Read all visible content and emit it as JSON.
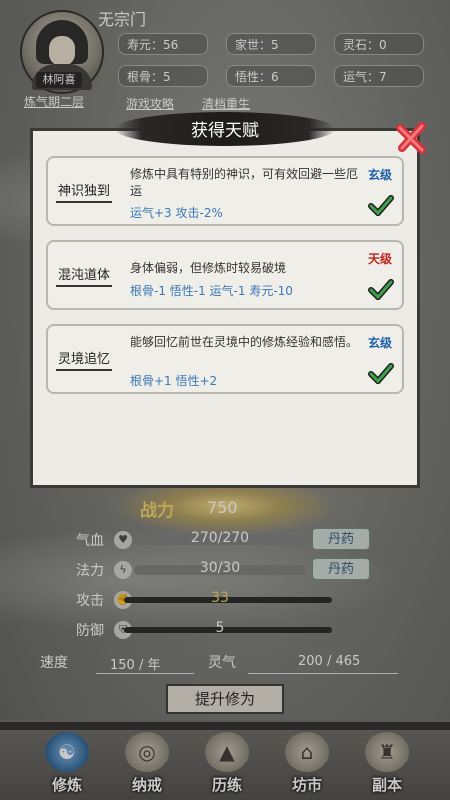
{
  "header": {
    "sect": "无宗门",
    "name": "林阿喜",
    "realm": "炼气期二层",
    "stats": {
      "lifespan": "寿元：56",
      "family": "家世：5",
      "spirit_stone": "灵石：0",
      "bone": "根骨：5",
      "comprehension": "悟性：6",
      "luck": "运气：7"
    },
    "links": {
      "guide": "游戏攻略",
      "reset": "清档重生"
    }
  },
  "modal": {
    "title": "获得天赋",
    "talents": [
      {
        "name": "神识独到",
        "desc": "修炼中具有特别的神识，可有效回避一些厄运",
        "effects": "运气+3  攻击-2%",
        "grade": "玄级",
        "grade_color": "#1f5fa8"
      },
      {
        "name": "混沌道体",
        "desc": "身体偏弱，但修炼时较易破境",
        "effects": "根骨-1  悟性-1  运气-1  寿元-10",
        "grade": "天级",
        "grade_color": "#c0241c"
      },
      {
        "name": "灵境追忆",
        "desc": "能够回忆前世在灵境中的修炼经验和感悟。",
        "effects": "根骨+1  悟性+2",
        "grade": "玄级",
        "grade_color": "#1f5fa8"
      }
    ]
  },
  "combat": {
    "power_label": "战力",
    "power_value": "750",
    "hp_label": "气血",
    "hp_text": "270/270",
    "hp_fraction": 1.0,
    "mp_label": "法力",
    "mp_text": "30/30",
    "mp_fraction": 1.0,
    "pill_label": "丹药",
    "attack_label": "攻击",
    "attack_value": "33",
    "defense_label": "防御",
    "defense_value": "5"
  },
  "cultivation": {
    "speed_label": "速度",
    "speed_value": "150 / 年",
    "qi_label": "灵气",
    "qi_value": "200 / 465",
    "upgrade_button": "提升修为"
  },
  "nav": [
    {
      "label": "修炼",
      "icon": "yin-yang-icon"
    },
    {
      "label": "纳戒",
      "icon": "ring-icon"
    },
    {
      "label": "历练",
      "icon": "mountain-icon"
    },
    {
      "label": "坊市",
      "icon": "market-icon"
    },
    {
      "label": "副本",
      "icon": "pagoda-icon"
    }
  ]
}
